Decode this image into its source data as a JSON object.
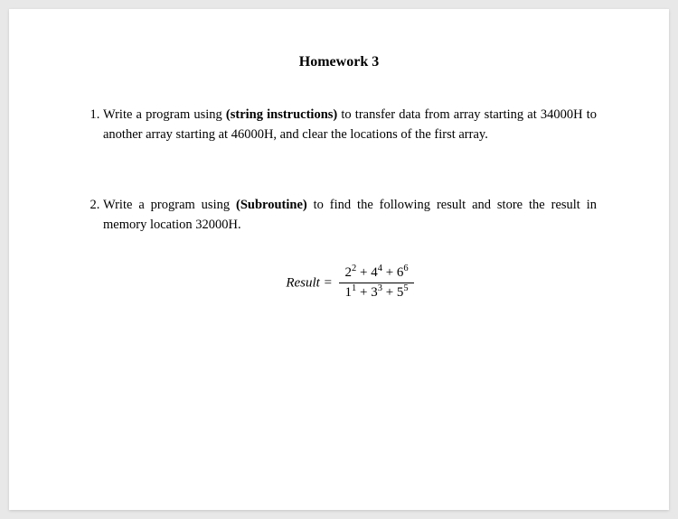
{
  "title": "Homework 3",
  "questions": {
    "q1": {
      "pre": "Write a program using ",
      "bold": "(string instructions)",
      "post": " to transfer data from array starting at 34000H to another array starting at 46000H, and clear the locations of the first array."
    },
    "q2": {
      "pre": "Write a program using ",
      "bold": "(Subroutine)",
      "post": " to find the following result and store the result in memory location 32000H."
    }
  },
  "formula": {
    "label": "Result",
    "equals": "=",
    "numerator": {
      "t1_base": "2",
      "t1_exp": "2",
      "t2_base": "4",
      "t2_exp": "4",
      "t3_base": "6",
      "t3_exp": "6"
    },
    "denominator": {
      "t1_base": "1",
      "t1_exp": "1",
      "t2_base": "3",
      "t2_exp": "3",
      "t3_base": "5",
      "t3_exp": "5"
    },
    "plus": " + "
  }
}
